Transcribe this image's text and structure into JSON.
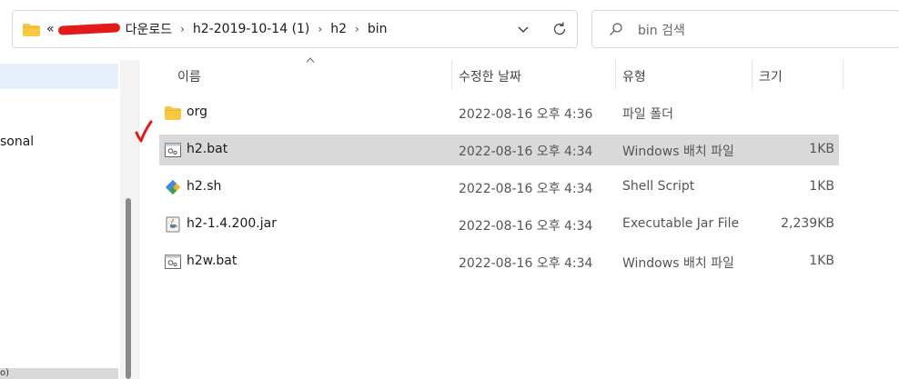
{
  "address": {
    "prefix": "«",
    "crumbs": [
      "다운로드",
      "h2-2019-10-14 (1)",
      "h2",
      "bin"
    ],
    "separator": "›"
  },
  "search": {
    "placeholder": "bin 검색"
  },
  "nav": {
    "partial_label": "sonal",
    "bottom_partial": "o)"
  },
  "columns": {
    "name": "이름",
    "date": "수정한 날짜",
    "type": "유형",
    "size": "크기"
  },
  "files": [
    {
      "name": "org",
      "date": "2022-08-16 오후 4:36",
      "type": "파일 폴더",
      "size": "",
      "icon": "folder-icon"
    },
    {
      "name": "h2.bat",
      "date": "2022-08-16 오후 4:34",
      "type": "Windows 배치 파일",
      "size": "1KB",
      "icon": "batch-file-icon"
    },
    {
      "name": "h2.sh",
      "date": "2022-08-16 오후 4:34",
      "type": "Shell Script",
      "size": "1KB",
      "icon": "shell-script-icon"
    },
    {
      "name": "h2-1.4.200.jar",
      "date": "2022-08-16 오후 4:34",
      "type": "Executable Jar File",
      "size": "2,239KB",
      "icon": "java-jar-icon"
    },
    {
      "name": "h2w.bat",
      "date": "2022-08-16 오후 4:34",
      "type": "Windows 배치 파일",
      "size": "1KB",
      "icon": "batch-file-icon"
    }
  ],
  "colors": {
    "selection": "#d9d9d9",
    "nav_selection": "#e5f0fb",
    "annotation_red": "#e21a1a",
    "folder_yellow": "#f8c845"
  }
}
